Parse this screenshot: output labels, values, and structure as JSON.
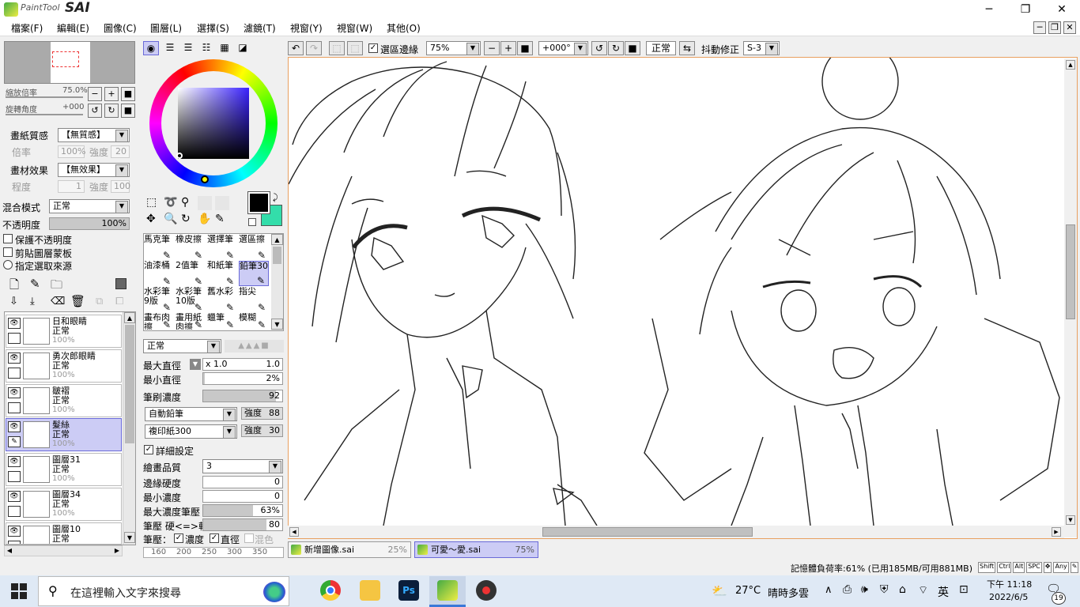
{
  "app": {
    "logo_text": "PaintTool",
    "logo_sai": "SAI"
  },
  "window_controls": {
    "minimize": "─",
    "maximize": "❐",
    "close": "✕"
  },
  "menu": [
    "檔案(F)",
    "編輯(E)",
    "圖像(C)",
    "圖層(L)",
    "選擇(S)",
    "濾鏡(T)",
    "視窗(Y)",
    "視窗(W)",
    "其他(O)"
  ],
  "navigator": {
    "zoom_label": "縮放倍率",
    "zoom_value": "75.0%",
    "rotate_label": "旋轉角度",
    "rotate_value": "+000"
  },
  "paper": {
    "texture_label": "畫紙質感",
    "texture_value": "【無質感】",
    "ratio_label": "倍率",
    "ratio_value": "100%",
    "strength_label": "強度",
    "strength_value": "20",
    "effect_label": "畫材效果",
    "effect_value": "【無效果】",
    "degree_label": "程度",
    "degree_value": "1",
    "strength2_label": "強度",
    "strength2_value": "100"
  },
  "blend": {
    "mode_label": "混合模式",
    "mode_value": "正常",
    "opacity_label": "不透明度",
    "opacity_value": "100%",
    "opacity_fraction": 1.0,
    "preserve_opacity": "保護不透明度",
    "clip_group": "剪貼圖層蒙板",
    "selection_source": "指定選取來源"
  },
  "layers": [
    {
      "name": "日和眼睛",
      "mode": "正常",
      "opacity": "100%",
      "selected": false
    },
    {
      "name": "勇次郎眼睛",
      "mode": "正常",
      "opacity": "100%",
      "selected": false
    },
    {
      "name": "皺褶",
      "mode": "正常",
      "opacity": "100%",
      "selected": false
    },
    {
      "name": "髮絲",
      "mode": "正常",
      "opacity": "100%",
      "selected": true
    },
    {
      "name": "圖層31",
      "mode": "正常",
      "opacity": "100%",
      "selected": false
    },
    {
      "name": "圖層34",
      "mode": "正常",
      "opacity": "100%",
      "selected": false
    },
    {
      "name": "圖層10",
      "mode": "正常",
      "opacity": "",
      "selected": false
    }
  ],
  "brushes": [
    {
      "name": "馬克筆",
      "selected": false
    },
    {
      "name": "橡皮擦",
      "selected": false
    },
    {
      "name": "選擇筆",
      "selected": false
    },
    {
      "name": "選區擦",
      "selected": false
    },
    {
      "name": "油漆桶",
      "selected": false
    },
    {
      "name": "2值筆",
      "selected": false
    },
    {
      "name": "和紙筆",
      "selected": false
    },
    {
      "name": "鉛筆30",
      "selected": true
    },
    {
      "name": "水彩筆9版",
      "selected": false
    },
    {
      "name": "水彩筆10版",
      "selected": false
    },
    {
      "name": "舊水彩",
      "selected": false
    },
    {
      "name": "指尖",
      "selected": false
    },
    {
      "name": "畫布肉擦",
      "selected": false
    },
    {
      "name": "畫用紙肉擦",
      "selected": false
    },
    {
      "name": "蠟筆",
      "selected": false
    },
    {
      "name": "模糊",
      "selected": false
    }
  ],
  "brush_settings": {
    "mode": "正常",
    "max_size_label": "最大直徑",
    "max_size_mult": "x 1.0",
    "max_size_value": "1.0",
    "min_size_label": "最小直徑",
    "min_size_value": "2%",
    "min_size_fraction": 0.02,
    "density_label": "筆刷濃度",
    "density_value": "92",
    "density_fraction": 0.92,
    "shape_value": "自動鉛筆",
    "shape_strength_label": "強度",
    "shape_strength_value": "88",
    "texture_value": "複印紙300",
    "texture_strength_label": "強度",
    "texture_strength_value": "30",
    "advanced_label": "詳細設定",
    "quality_label": "繪畫品質",
    "quality_value": "3",
    "edge_label": "邊緣硬度",
    "edge_value": "0",
    "min_density_label": "最小濃度",
    "min_density_value": "0",
    "max_pressure_label": "最大濃度筆壓",
    "max_pressure_value": "63%",
    "max_pressure_fraction": 0.63,
    "hardness_label": "筆壓 硬<=>軟",
    "hardness_value": "80",
    "hardness_fraction": 0.8,
    "pressure_label": "筆壓：",
    "p_density": "濃度",
    "p_size": "直徑",
    "p_blend": "混色"
  },
  "size_presets": [
    "160",
    "200",
    "250",
    "300",
    "350"
  ],
  "toolbar": {
    "selection_edge_label": "選區邊緣",
    "zoom_value": "75%",
    "angle_value": "+000°",
    "mode_value": "正常",
    "stabilizer_label": "抖動修正",
    "stabilizer_value": "S-3"
  },
  "tabs": [
    {
      "name": "新增圖像.sai",
      "zoom": "25%",
      "active": false
    },
    {
      "name": "可愛～愛.sai",
      "zoom": "75%",
      "active": true
    }
  ],
  "status": {
    "memory": "記憶體負荷率:61% (已用185MB/可用881MB)",
    "keys": [
      "Shift",
      "Ctrl",
      "Alt",
      "SPC",
      "Any"
    ]
  },
  "taskbar": {
    "search_placeholder": "在這裡輸入文字來搜尋",
    "temperature": "27°C",
    "weather": "晴時多雲",
    "ime": "英",
    "time": "下午 11:18",
    "date": "2022/6/5",
    "notification_count": "19"
  },
  "colors": {
    "primary": "#000000",
    "secondary": "#33ddaa",
    "accent": "#6a6ad8",
    "selected_bg": "#ccccf5"
  }
}
